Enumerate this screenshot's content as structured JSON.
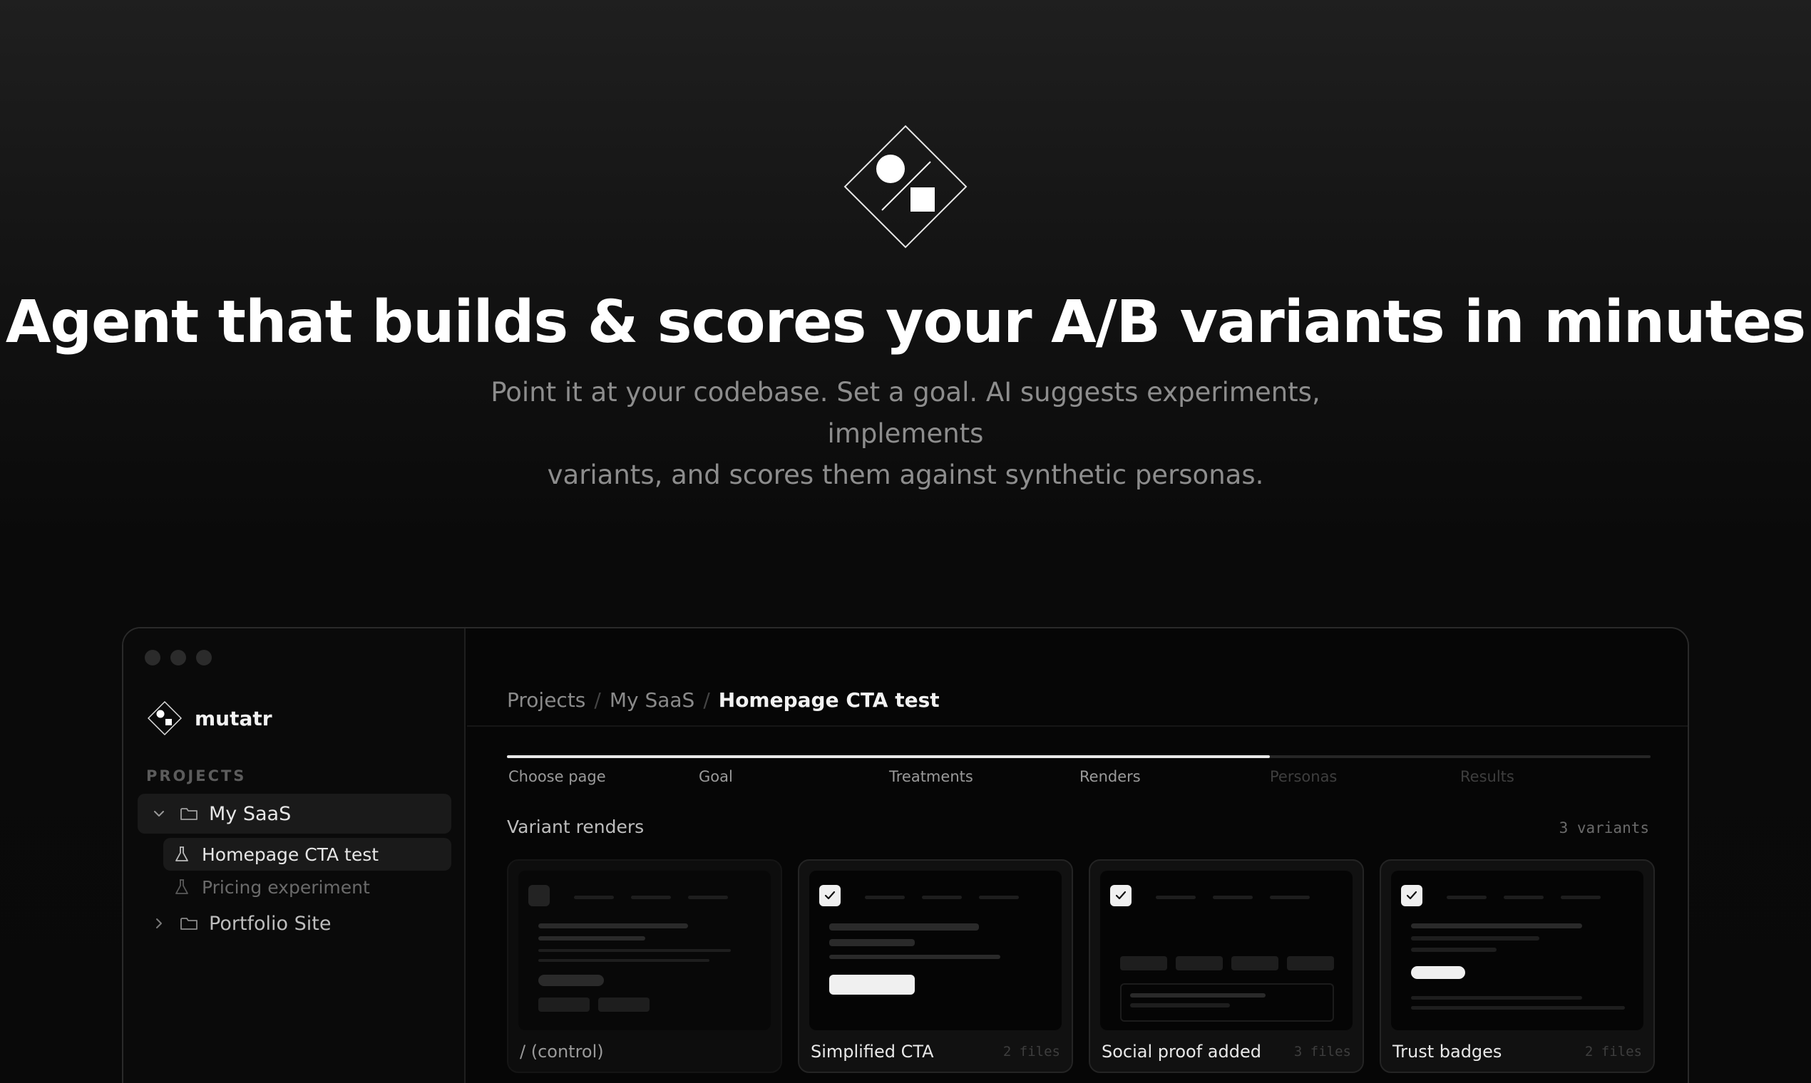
{
  "hero": {
    "title": "Agent that builds & scores your A/B variants in minutes",
    "subtitle_line1": "Point it at your codebase. Set a goal. AI suggests experiments, implements",
    "subtitle_line2": "variants, and scores them against synthetic personas."
  },
  "sidebar": {
    "brand": "mutatr",
    "section_label": "PROJECTS",
    "projects": [
      {
        "label": "My SaaS",
        "expanded": true,
        "active": true,
        "children": [
          {
            "label": "Homepage CTA test",
            "active": true
          },
          {
            "label": "Pricing experiment",
            "active": false
          }
        ]
      },
      {
        "label": "Portfolio Site",
        "expanded": false,
        "active": false
      }
    ]
  },
  "main": {
    "breadcrumb": [
      "Projects",
      "My SaaS",
      "Homepage CTA test"
    ],
    "breadcrumb_separator": "/",
    "steps": [
      {
        "label": "Choose page",
        "done": true
      },
      {
        "label": "Goal",
        "done": true
      },
      {
        "label": "Treatments",
        "done": true
      },
      {
        "label": "Renders",
        "done": true
      },
      {
        "label": "Personas",
        "done": false
      },
      {
        "label": "Results",
        "done": false
      }
    ],
    "progress_fraction": 0.667,
    "renders_title": "Variant renders",
    "renders_count": "3 variants",
    "cards": [
      {
        "name": "/ (control)",
        "files": "",
        "checked": false
      },
      {
        "name": "Simplified CTA",
        "files": "2 files",
        "checked": true
      },
      {
        "name": "Social proof added",
        "files": "3 files",
        "checked": true
      },
      {
        "name": "Trust badges",
        "files": "2 files",
        "checked": true
      }
    ]
  },
  "colors": {
    "background": "#0b0b0b",
    "accent": "#f2f2f2",
    "muted_text": "#8d8d8d"
  }
}
